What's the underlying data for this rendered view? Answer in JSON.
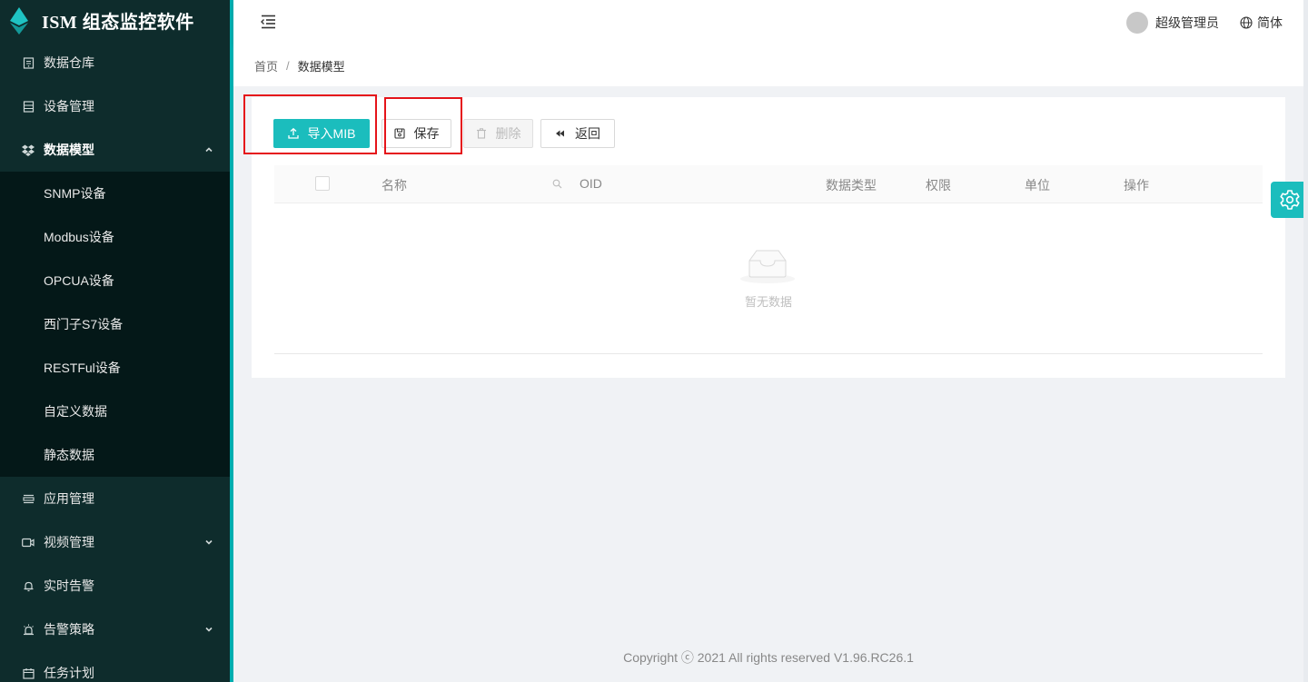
{
  "app": {
    "title": "ISM 组态监控软件"
  },
  "sidebar": {
    "items": [
      {
        "label": "数据仓库",
        "icon": "database-icon"
      },
      {
        "label": "设备管理",
        "icon": "device-icon"
      },
      {
        "label": "数据模型",
        "icon": "dropbox-icon",
        "expanded": true,
        "children": [
          "SNMP设备",
          "Modbus设备",
          "OPCUA设备",
          "西门子S7设备",
          "RESTFul设备",
          "自定义数据",
          "静态数据"
        ]
      },
      {
        "label": "应用管理",
        "icon": "app-icon"
      },
      {
        "label": "视频管理",
        "icon": "video-icon",
        "collapsible": true
      },
      {
        "label": "实时告警",
        "icon": "bell-icon"
      },
      {
        "label": "告警策略",
        "icon": "alarm-icon",
        "collapsible": true
      },
      {
        "label": "任务计划",
        "icon": "calendar-icon"
      }
    ]
  },
  "header": {
    "user": "超级管理员",
    "language": "简体"
  },
  "breadcrumb": {
    "home": "首页",
    "separator": "/",
    "current": "数据模型"
  },
  "toolbar": {
    "import_label": "导入MIB",
    "save_label": "保存",
    "delete_label": "删除",
    "back_label": "返回"
  },
  "table": {
    "columns": [
      "名称",
      "OID",
      "数据类型",
      "权限",
      "单位",
      "操作"
    ],
    "empty_text": "暂无数据"
  },
  "footer": {
    "copyright": "Copyright ⓒ 2021 All rights reserved V1.96.RC26.1"
  },
  "colors": {
    "accent": "#1bbdbd",
    "sidebar_bg": "#0e2c2c",
    "submenu_bg": "#041818",
    "highlight": "#e5141a"
  }
}
